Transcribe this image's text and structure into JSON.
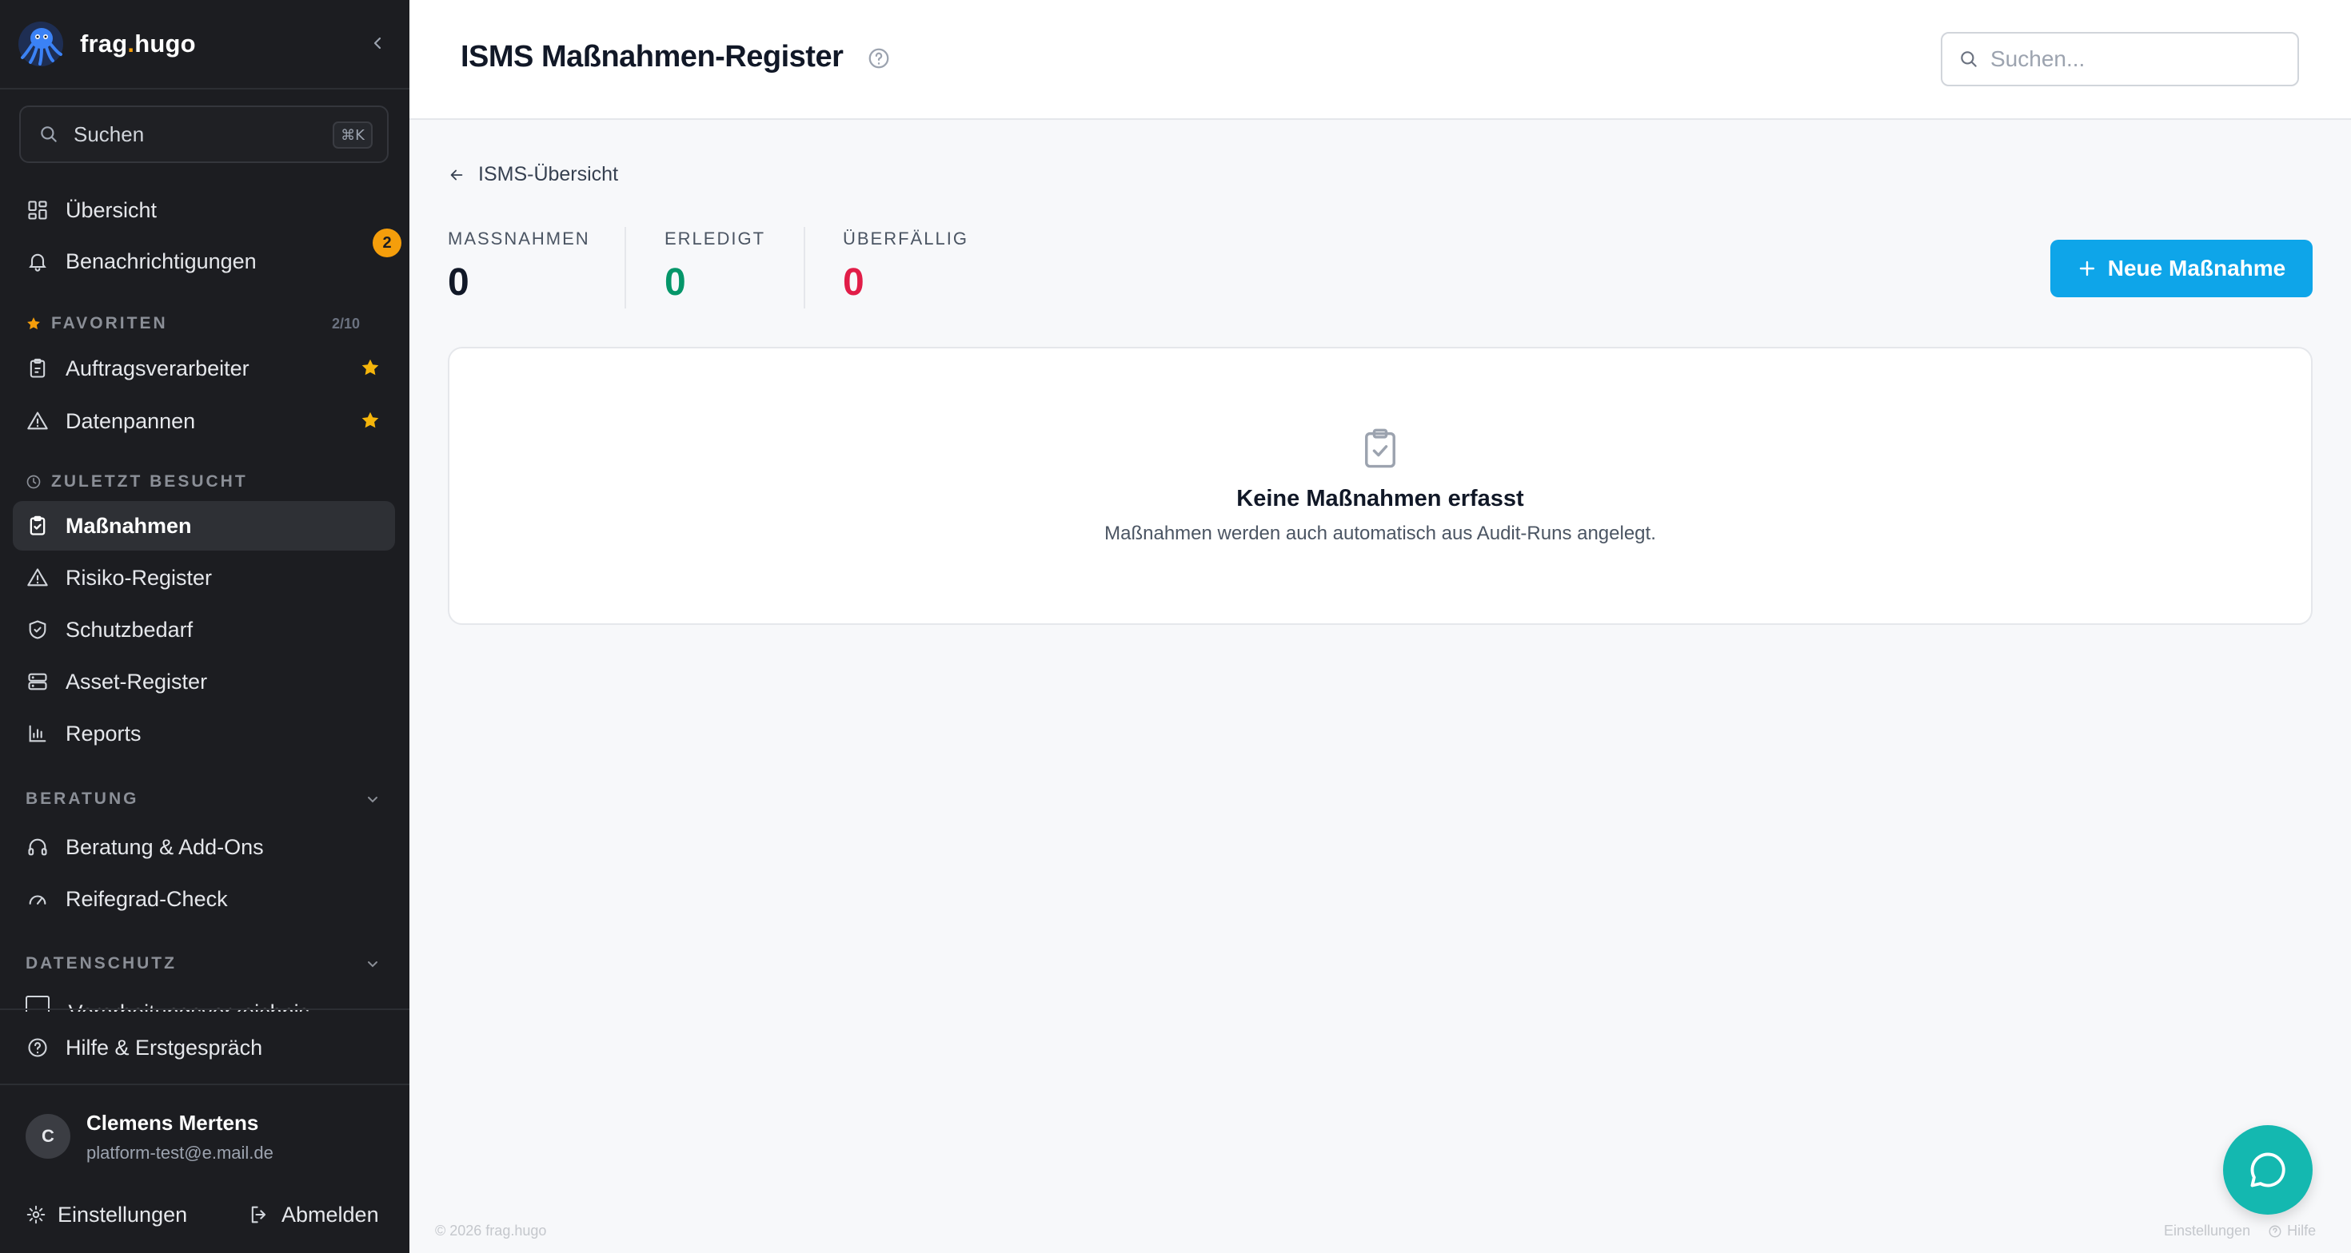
{
  "brand": {
    "name_main": "frag",
    "name_dot": ".",
    "name_rest": "hugo"
  },
  "sidebar": {
    "search_label": "Suchen",
    "search_shortcut": "⌘K",
    "nav": [
      {
        "label": "Übersicht",
        "icon": "dashboard-icon"
      },
      {
        "label": "Benachrichtigungen",
        "icon": "bell-icon",
        "badge": "2"
      }
    ],
    "favorites": {
      "title": "FAVORITEN",
      "count": "2/10",
      "items": [
        {
          "label": "Auftragsverarbeiter",
          "icon": "clipboard-icon"
        },
        {
          "label": "Datenpannen",
          "icon": "warning-icon"
        }
      ]
    },
    "recent": {
      "title": "ZULETZT BESUCHT",
      "items": [
        {
          "label": "Maßnahmen",
          "icon": "clipboard-check-icon",
          "active": true
        },
        {
          "label": "Risiko-Register",
          "icon": "warning-icon"
        },
        {
          "label": "Schutzbedarf",
          "icon": "shield-check-icon"
        },
        {
          "label": "Asset-Register",
          "icon": "server-icon"
        },
        {
          "label": "Reports",
          "icon": "bar-chart-icon"
        }
      ]
    },
    "beratung": {
      "title": "BERATUNG",
      "items": [
        {
          "label": "Beratung & Add-Ons",
          "icon": "headphones-icon"
        },
        {
          "label": "Reifegrad-Check",
          "icon": "gauge-icon"
        }
      ]
    },
    "datenschutz": {
      "title": "DATENSCHUTZ",
      "partial_item": "Verarbeitungsverzeichnis"
    },
    "help": "Hilfe & Erstgespräch",
    "user": {
      "initial": "C",
      "name": "Clemens Mertens",
      "email": "platform-test@e.mail.de"
    },
    "settings": "Einstellungen",
    "logout": "Abmelden"
  },
  "header": {
    "title": "ISMS Maßnahmen-Register",
    "search_placeholder": "Suchen..."
  },
  "main": {
    "back_link": "ISMS-Übersicht",
    "stats": [
      {
        "label": "MASSNAHMEN",
        "value": "0",
        "color": "#111827"
      },
      {
        "label": "ERLEDIGT",
        "value": "0",
        "color": "#059669"
      },
      {
        "label": "ÜBERFÄLLIG",
        "value": "0",
        "color": "#e11d48"
      }
    ],
    "new_button": "Neue Maßnahme",
    "empty_title": "Keine Maßnahmen erfasst",
    "empty_subtitle": "Maßnahmen werden auch automatisch aus Audit-Runs angelegt."
  },
  "footer": {
    "copyright": "© 2026 frag.hugo",
    "settings": "Einstellungen",
    "help": "Hilfe"
  },
  "colors": {
    "sidebar_bg": "#1c1d21",
    "accent_blue": "#0ea5e9",
    "badge_amber": "#f59e0b",
    "chat_teal": "#14b8b0"
  }
}
